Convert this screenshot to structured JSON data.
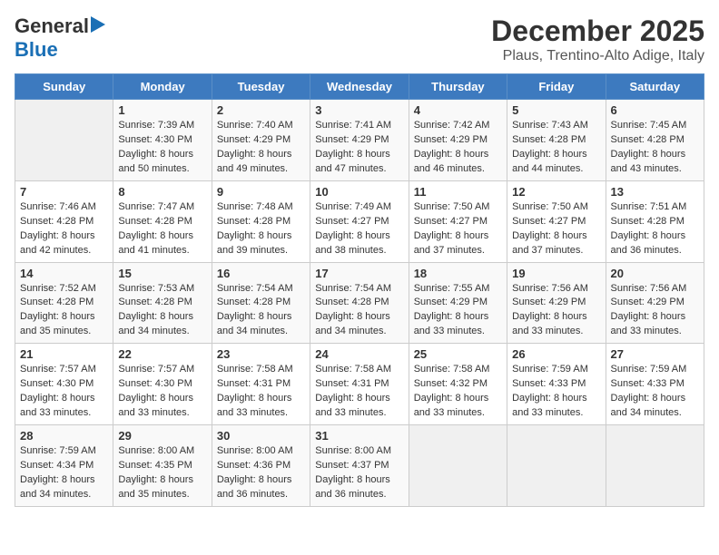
{
  "logo": {
    "line1": "General",
    "line2": "Blue"
  },
  "title": "December 2025",
  "subtitle": "Plaus, Trentino-Alto Adige, Italy",
  "days_header": [
    "Sunday",
    "Monday",
    "Tuesday",
    "Wednesday",
    "Thursday",
    "Friday",
    "Saturday"
  ],
  "weeks": [
    [
      {
        "num": "",
        "sunrise": "",
        "sunset": "",
        "daylight": ""
      },
      {
        "num": "1",
        "sunrise": "Sunrise: 7:39 AM",
        "sunset": "Sunset: 4:30 PM",
        "daylight": "Daylight: 8 hours and 50 minutes."
      },
      {
        "num": "2",
        "sunrise": "Sunrise: 7:40 AM",
        "sunset": "Sunset: 4:29 PM",
        "daylight": "Daylight: 8 hours and 49 minutes."
      },
      {
        "num": "3",
        "sunrise": "Sunrise: 7:41 AM",
        "sunset": "Sunset: 4:29 PM",
        "daylight": "Daylight: 8 hours and 47 minutes."
      },
      {
        "num": "4",
        "sunrise": "Sunrise: 7:42 AM",
        "sunset": "Sunset: 4:29 PM",
        "daylight": "Daylight: 8 hours and 46 minutes."
      },
      {
        "num": "5",
        "sunrise": "Sunrise: 7:43 AM",
        "sunset": "Sunset: 4:28 PM",
        "daylight": "Daylight: 8 hours and 44 minutes."
      },
      {
        "num": "6",
        "sunrise": "Sunrise: 7:45 AM",
        "sunset": "Sunset: 4:28 PM",
        "daylight": "Daylight: 8 hours and 43 minutes."
      }
    ],
    [
      {
        "num": "7",
        "sunrise": "Sunrise: 7:46 AM",
        "sunset": "Sunset: 4:28 PM",
        "daylight": "Daylight: 8 hours and 42 minutes."
      },
      {
        "num": "8",
        "sunrise": "Sunrise: 7:47 AM",
        "sunset": "Sunset: 4:28 PM",
        "daylight": "Daylight: 8 hours and 41 minutes."
      },
      {
        "num": "9",
        "sunrise": "Sunrise: 7:48 AM",
        "sunset": "Sunset: 4:28 PM",
        "daylight": "Daylight: 8 hours and 39 minutes."
      },
      {
        "num": "10",
        "sunrise": "Sunrise: 7:49 AM",
        "sunset": "Sunset: 4:27 PM",
        "daylight": "Daylight: 8 hours and 38 minutes."
      },
      {
        "num": "11",
        "sunrise": "Sunrise: 7:50 AM",
        "sunset": "Sunset: 4:27 PM",
        "daylight": "Daylight: 8 hours and 37 minutes."
      },
      {
        "num": "12",
        "sunrise": "Sunrise: 7:50 AM",
        "sunset": "Sunset: 4:27 PM",
        "daylight": "Daylight: 8 hours and 37 minutes."
      },
      {
        "num": "13",
        "sunrise": "Sunrise: 7:51 AM",
        "sunset": "Sunset: 4:28 PM",
        "daylight": "Daylight: 8 hours and 36 minutes."
      }
    ],
    [
      {
        "num": "14",
        "sunrise": "Sunrise: 7:52 AM",
        "sunset": "Sunset: 4:28 PM",
        "daylight": "Daylight: 8 hours and 35 minutes."
      },
      {
        "num": "15",
        "sunrise": "Sunrise: 7:53 AM",
        "sunset": "Sunset: 4:28 PM",
        "daylight": "Daylight: 8 hours and 34 minutes."
      },
      {
        "num": "16",
        "sunrise": "Sunrise: 7:54 AM",
        "sunset": "Sunset: 4:28 PM",
        "daylight": "Daylight: 8 hours and 34 minutes."
      },
      {
        "num": "17",
        "sunrise": "Sunrise: 7:54 AM",
        "sunset": "Sunset: 4:28 PM",
        "daylight": "Daylight: 8 hours and 34 minutes."
      },
      {
        "num": "18",
        "sunrise": "Sunrise: 7:55 AM",
        "sunset": "Sunset: 4:29 PM",
        "daylight": "Daylight: 8 hours and 33 minutes."
      },
      {
        "num": "19",
        "sunrise": "Sunrise: 7:56 AM",
        "sunset": "Sunset: 4:29 PM",
        "daylight": "Daylight: 8 hours and 33 minutes."
      },
      {
        "num": "20",
        "sunrise": "Sunrise: 7:56 AM",
        "sunset": "Sunset: 4:29 PM",
        "daylight": "Daylight: 8 hours and 33 minutes."
      }
    ],
    [
      {
        "num": "21",
        "sunrise": "Sunrise: 7:57 AM",
        "sunset": "Sunset: 4:30 PM",
        "daylight": "Daylight: 8 hours and 33 minutes."
      },
      {
        "num": "22",
        "sunrise": "Sunrise: 7:57 AM",
        "sunset": "Sunset: 4:30 PM",
        "daylight": "Daylight: 8 hours and 33 minutes."
      },
      {
        "num": "23",
        "sunrise": "Sunrise: 7:58 AM",
        "sunset": "Sunset: 4:31 PM",
        "daylight": "Daylight: 8 hours and 33 minutes."
      },
      {
        "num": "24",
        "sunrise": "Sunrise: 7:58 AM",
        "sunset": "Sunset: 4:31 PM",
        "daylight": "Daylight: 8 hours and 33 minutes."
      },
      {
        "num": "25",
        "sunrise": "Sunrise: 7:58 AM",
        "sunset": "Sunset: 4:32 PM",
        "daylight": "Daylight: 8 hours and 33 minutes."
      },
      {
        "num": "26",
        "sunrise": "Sunrise: 7:59 AM",
        "sunset": "Sunset: 4:33 PM",
        "daylight": "Daylight: 8 hours and 33 minutes."
      },
      {
        "num": "27",
        "sunrise": "Sunrise: 7:59 AM",
        "sunset": "Sunset: 4:33 PM",
        "daylight": "Daylight: 8 hours and 34 minutes."
      }
    ],
    [
      {
        "num": "28",
        "sunrise": "Sunrise: 7:59 AM",
        "sunset": "Sunset: 4:34 PM",
        "daylight": "Daylight: 8 hours and 34 minutes."
      },
      {
        "num": "29",
        "sunrise": "Sunrise: 8:00 AM",
        "sunset": "Sunset: 4:35 PM",
        "daylight": "Daylight: 8 hours and 35 minutes."
      },
      {
        "num": "30",
        "sunrise": "Sunrise: 8:00 AM",
        "sunset": "Sunset: 4:36 PM",
        "daylight": "Daylight: 8 hours and 36 minutes."
      },
      {
        "num": "31",
        "sunrise": "Sunrise: 8:00 AM",
        "sunset": "Sunset: 4:37 PM",
        "daylight": "Daylight: 8 hours and 36 minutes."
      },
      {
        "num": "",
        "sunrise": "",
        "sunset": "",
        "daylight": ""
      },
      {
        "num": "",
        "sunrise": "",
        "sunset": "",
        "daylight": ""
      },
      {
        "num": "",
        "sunrise": "",
        "sunset": "",
        "daylight": ""
      }
    ]
  ]
}
